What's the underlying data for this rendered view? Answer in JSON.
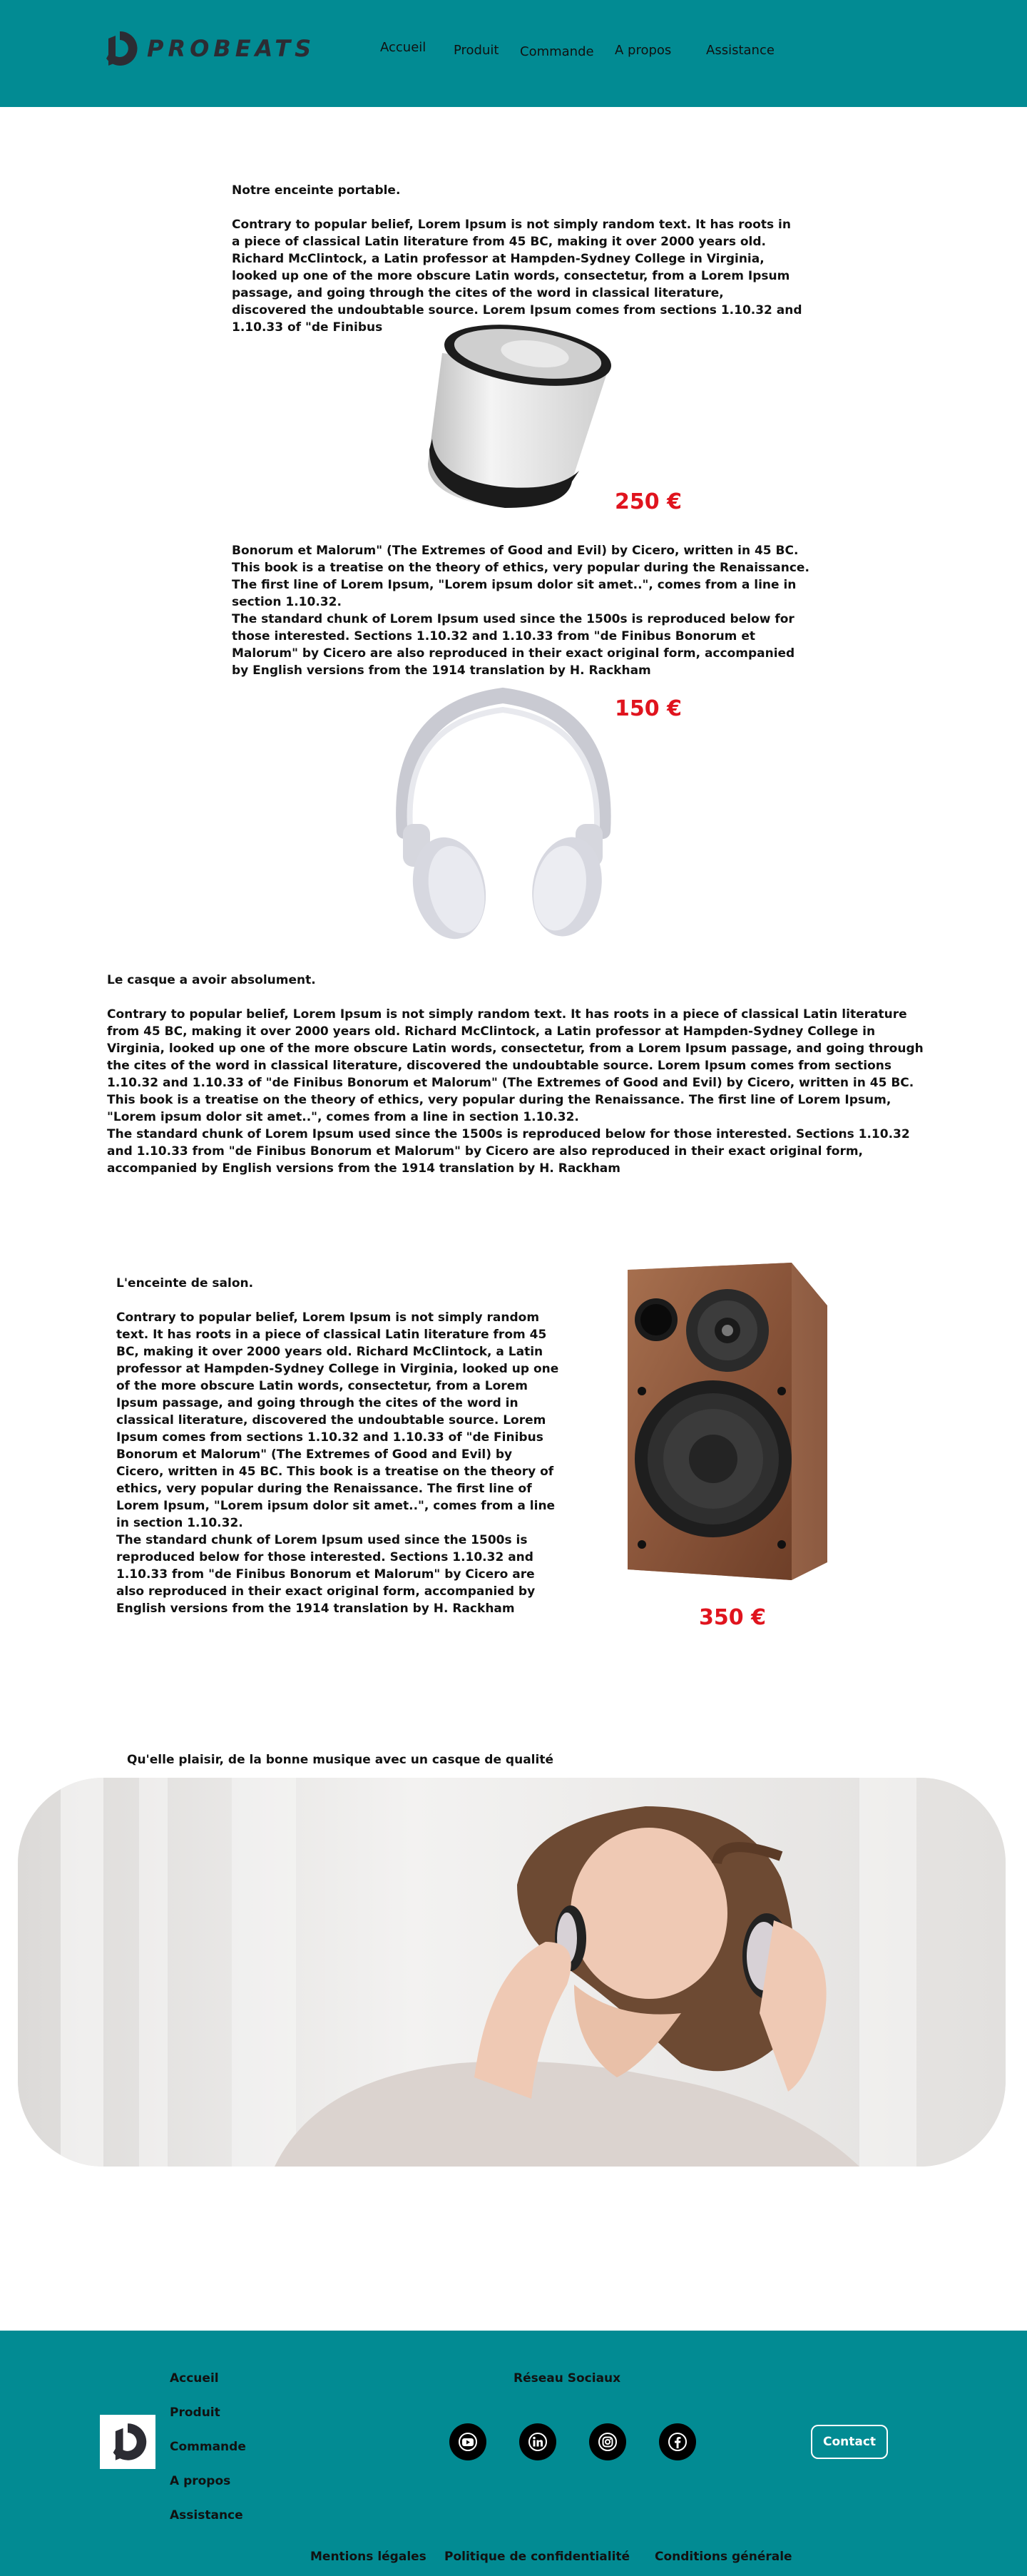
{
  "brand": {
    "name": "PROBEATS"
  },
  "nav": {
    "items": [
      {
        "label": "Accueil"
      },
      {
        "label": "Produit"
      },
      {
        "label": "Commande"
      },
      {
        "label": "A propos"
      },
      {
        "label": "Assistance"
      }
    ]
  },
  "section_portable": {
    "heading": "Notre enceinte portable.",
    "para1": "Contrary to popular belief, Lorem Ipsum is not simply random text. It has roots in a piece of classical Latin literature from 45 BC, making it over 2000 years old. Richard McClintock, a Latin professor at Hampden-Sydney College in Virginia, looked up one of the more obscure Latin words, consectetur, from a Lorem Ipsum passage, and going through the cites of the word in classical literature, discovered the undoubtable source. Lorem Ipsum comes from sections 1.10.32 and 1.10.33 of \"de Finibus",
    "price": "250 €",
    "para2": " Bonorum et Malorum\" (The Extremes of Good and Evil) by Cicero, written in 45 BC. This book is a treatise on the theory of ethics, very popular during the Renaissance. The first line of Lorem Ipsum, \"Lorem ipsum dolor sit amet..\", comes from a line in section 1.10.32.",
    "para3": "The standard chunk of Lorem Ipsum used since the 1500s is reproduced below for those interested. Sections 1.10.32 and 1.10.33 from \"de Finibus Bonorum et Malorum\" by Cicero are also reproduced in their exact original form, accompanied by English versions from the 1914 translation by H. Rackham"
  },
  "section_headphones": {
    "price": "150 €",
    "heading": "Le casque a avoir absolument.",
    "para1": "Contrary to popular belief, Lorem Ipsum is not simply random text. It has roots in a piece of classical Latin literature from 45 BC, making it over 2000 years old. Richard McClintock, a Latin professor at Hampden-Sydney College in Virginia, looked up one of the more obscure Latin words, consectetur, from a Lorem Ipsum passage, and going through the cites of the word in classical literature, discovered the undoubtable source. Lorem Ipsum comes from sections 1.10.32 and 1.10.33 of \"de Finibus Bonorum et Malorum\" (The Extremes of Good and Evil) by Cicero, written in 45 BC. This book is a treatise on the theory of ethics, very popular during the Renaissance. The first line of Lorem Ipsum, \"Lorem ipsum dolor sit amet..\", comes from a line in section 1.10.32.",
    "para2": "The standard chunk of Lorem Ipsum used since the 1500s is reproduced below for those interested. Sections 1.10.32 and 1.10.33 from \"de Finibus Bonorum et Malorum\" by Cicero are also reproduced in their exact original form, accompanied by English versions from the 1914 translation by H. Rackham"
  },
  "section_salon": {
    "heading": "L'enceinte de salon.",
    "para1": "Contrary to popular belief, Lorem Ipsum is not simply random text. It has roots in a piece of classical Latin literature from 45 BC, making it over 2000 years old. Richard McClintock, a Latin professor at Hampden-Sydney College in Virginia, looked up one of the more obscure Latin words, consectetur, from a Lorem Ipsum passage, and going through the cites of the word in classical literature, discovered the undoubtable source. Lorem Ipsum comes from sections 1.10.32 and 1.10.33 of \"de Finibus Bonorum et Malorum\" (The Extremes of Good and Evil) by Cicero, written in 45 BC. This book is a treatise on the theory of ethics, very popular during the Renaissance. The first line of Lorem Ipsum, \"Lorem ipsum dolor sit amet..\", comes from a line in section 1.10.32.",
    "para2": "The standard chunk of Lorem Ipsum used since the 1500s is reproduced below for those interested. Sections 1.10.32 and 1.10.33 from \"de Finibus Bonorum et Malorum\" by Cicero are also reproduced in their exact original form, accompanied by English versions from the 1914 translation by H. Rackham",
    "price": "350 €"
  },
  "banner": {
    "caption": "Qu'elle plaisir, de la bonne musique avec un casque de qualité"
  },
  "footer": {
    "links": [
      {
        "label": "Accueil"
      },
      {
        "label": "Produit"
      },
      {
        "label": "Commande"
      },
      {
        "label": "A propos"
      },
      {
        "label": "Assistance"
      }
    ],
    "social_title": "Réseau Sociaux",
    "social_icons": [
      "youtube-icon",
      "linkedin-icon",
      "instagram-icon",
      "facebook-icon"
    ],
    "contact_label": "Contact",
    "legal": [
      {
        "label": "Mentions légales"
      },
      {
        "label": "Politique de confidentialité"
      },
      {
        "label": "Conditions générale"
      }
    ]
  },
  "colors": {
    "brand_teal": "#028b93",
    "price_red": "#e0141e",
    "logo_dark": "#2c2c33"
  }
}
